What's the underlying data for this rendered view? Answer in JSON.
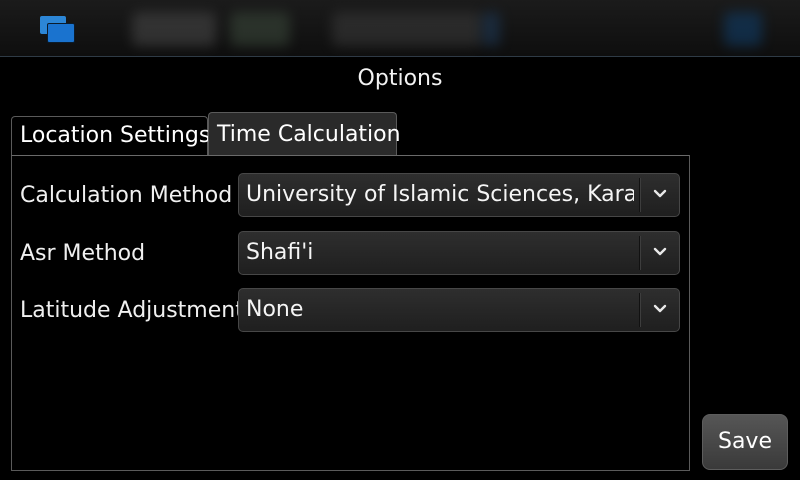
{
  "window": {
    "title": "Options"
  },
  "tabs": [
    {
      "label": "Location Settings",
      "active": false
    },
    {
      "label": "Time Calculation",
      "active": true
    }
  ],
  "fields": {
    "calculation_method": {
      "label": "Calculation Method",
      "value": "University of Islamic Sciences, Karachi"
    },
    "asr_method": {
      "label": "Asr Method",
      "value": "Shafi'i"
    },
    "latitude_adjustment": {
      "label": "Latitude Adjustment",
      "value": "None"
    }
  },
  "actions": {
    "save_label": "Save"
  },
  "icons": {
    "task_switcher": "task-switcher-icon",
    "dropdown": "chevron-down-icon"
  },
  "colors": {
    "background": "#000000",
    "accent": "#1a73cf",
    "control": "#2a2a2a"
  }
}
